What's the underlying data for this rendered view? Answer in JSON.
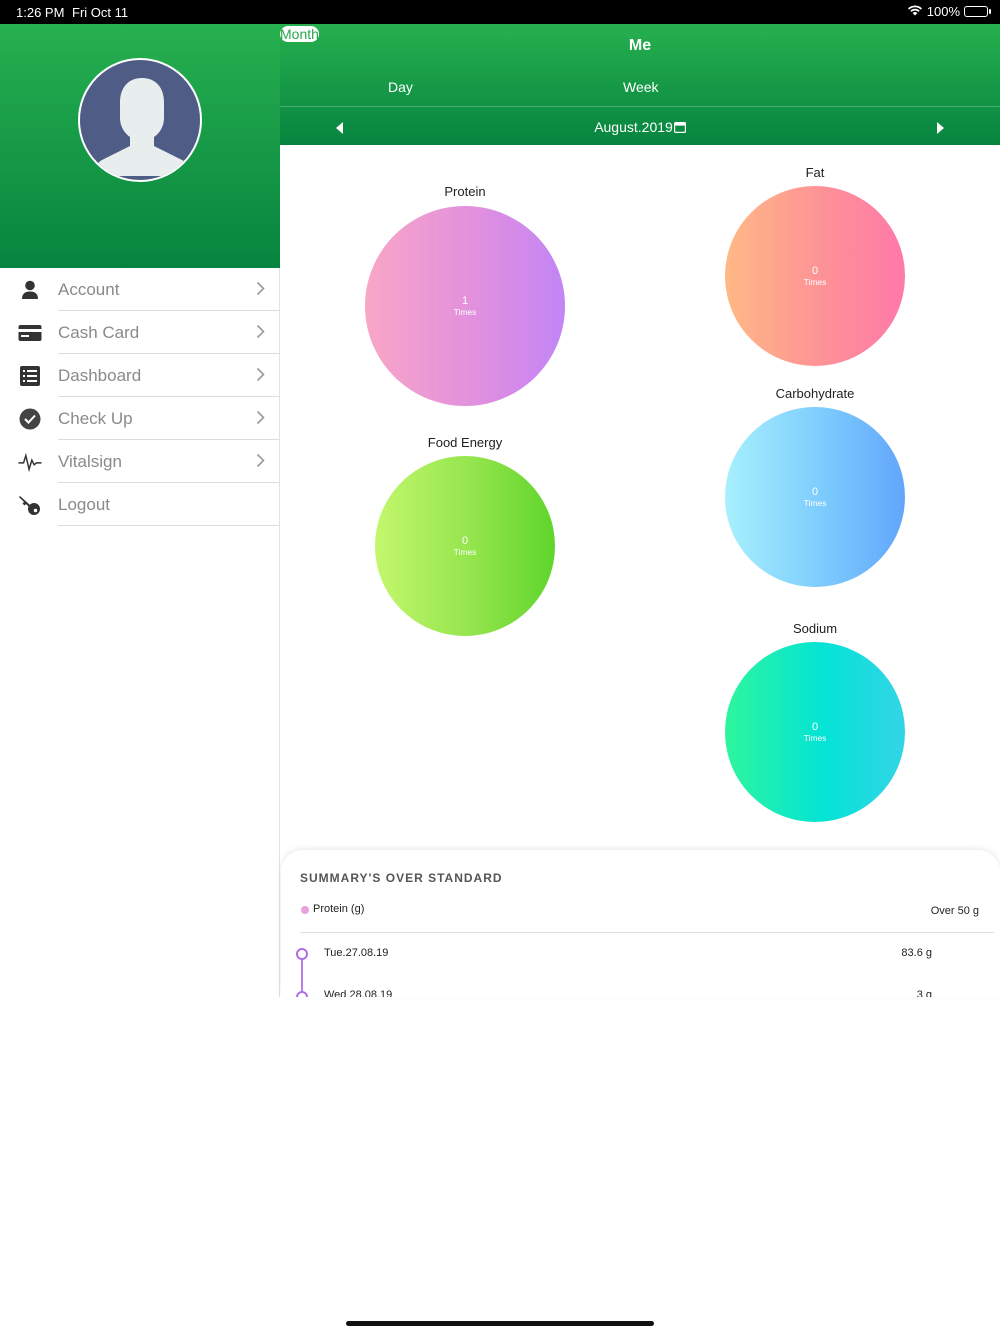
{
  "status_bar": {
    "time": "1:26 PM",
    "date": "Fri Oct 11",
    "battery": "100%",
    "battery_level": 1.0
  },
  "sidebar": {
    "avatar_icon": "person-silhouette-icon",
    "items": [
      {
        "label": "Account",
        "icon": "person-icon",
        "has_chevron": true
      },
      {
        "label": "Cash Card",
        "icon": "card-icon",
        "has_chevron": true
      },
      {
        "label": "Dashboard",
        "icon": "list-icon",
        "has_chevron": true
      },
      {
        "label": "Check Up",
        "icon": "check-circle-icon",
        "has_chevron": true
      },
      {
        "label": "Vitalsign",
        "icon": "pulse-icon",
        "has_chevron": true
      },
      {
        "label": "Logout",
        "icon": "key-icon",
        "has_chevron": false
      }
    ]
  },
  "header": {
    "title": "Me",
    "tabs": [
      {
        "label": "Day",
        "selected": false
      },
      {
        "label": "Week",
        "selected": false
      },
      {
        "label": "Month",
        "selected": true
      }
    ],
    "period": "August.2019"
  },
  "nutrients": {
    "protein": {
      "name": "Protein",
      "count": "1",
      "unit": "Times"
    },
    "fat": {
      "name": "Fat",
      "count": "0",
      "unit": "Times"
    },
    "carbohydrate": {
      "name": "Carbohydrate",
      "count": "0",
      "unit": "Times"
    },
    "food_energy": {
      "name": "Food Energy",
      "count": "0",
      "unit": "Times"
    },
    "sodium": {
      "name": "Sodium",
      "count": "0",
      "unit": "Times"
    }
  },
  "summary": {
    "title": "SUMMARY'S OVER STANDARD",
    "nutrient": "Protein (g)",
    "standard": "Over 50 g",
    "entries": [
      {
        "date": "Tue.27.08.19",
        "value": "83.6 g"
      },
      {
        "date": "Wed.28.08.19",
        "value": "3 g"
      }
    ]
  },
  "colors": {
    "header_green_top": "#27b04f",
    "header_green_bottom": "#06843f",
    "accent_green": "#29a44c",
    "timeline_purple": "#b06de4"
  }
}
